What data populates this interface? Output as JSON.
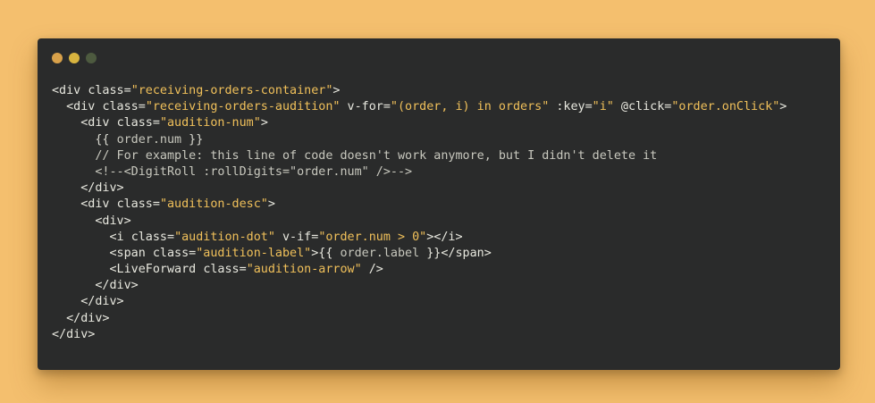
{
  "window": {
    "traffic_lights": [
      {
        "name": "close",
        "color": "#d8a14a"
      },
      {
        "name": "minimize",
        "color": "#d8b43f"
      },
      {
        "name": "maximize",
        "color": "#4d5a3f"
      }
    ]
  },
  "code": {
    "colors": {
      "string": "#f0c05a",
      "text": "#e8e8df",
      "background": "#2a2b2b",
      "page_background": "#f4bf6e"
    },
    "lines": [
      [
        {
          "t": "<div ",
          "k": "tag"
        },
        {
          "t": "class=",
          "k": "attr"
        },
        {
          "t": "\"receiving-orders-container\"",
          "k": "str"
        },
        {
          "t": ">",
          "k": "punc"
        }
      ],
      [
        {
          "t": "  <div ",
          "k": "tag"
        },
        {
          "t": "class=",
          "k": "attr"
        },
        {
          "t": "\"receiving-orders-audition\"",
          "k": "str"
        },
        {
          "t": " v-for=",
          "k": "attr"
        },
        {
          "t": "\"(order, i) in orders\"",
          "k": "str"
        },
        {
          "t": " :key=",
          "k": "attr"
        },
        {
          "t": "\"i\"",
          "k": "str"
        },
        {
          "t": " @click=",
          "k": "attr"
        },
        {
          "t": "\"order.onClick\"",
          "k": "str"
        },
        {
          "t": ">",
          "k": "punc"
        }
      ],
      [
        {
          "t": "    <div ",
          "k": "tag"
        },
        {
          "t": "class=",
          "k": "attr"
        },
        {
          "t": "\"audition-num\"",
          "k": "str"
        },
        {
          "t": ">",
          "k": "punc"
        }
      ],
      [
        {
          "t": "      {{ ",
          "k": "plain"
        },
        {
          "t": "order.num",
          "k": "expr"
        },
        {
          "t": " }}",
          "k": "plain"
        }
      ],
      [
        {
          "t": "      // For example: this line of code doesn't work anymore, but I didn't delete it",
          "k": "comment"
        }
      ],
      [
        {
          "t": "      <!--<DigitRoll :rollDigits=\"order.num\" />-->",
          "k": "comment"
        }
      ],
      [
        {
          "t": "    </div>",
          "k": "tag"
        }
      ],
      [
        {
          "t": "    <div ",
          "k": "tag"
        },
        {
          "t": "class=",
          "k": "attr"
        },
        {
          "t": "\"audition-desc\"",
          "k": "str"
        },
        {
          "t": ">",
          "k": "punc"
        }
      ],
      [
        {
          "t": "      <div>",
          "k": "tag"
        }
      ],
      [
        {
          "t": "        <i ",
          "k": "tag"
        },
        {
          "t": "class=",
          "k": "attr"
        },
        {
          "t": "\"audition-dot\"",
          "k": "str"
        },
        {
          "t": " v-if=",
          "k": "attr"
        },
        {
          "t": "\"order.num > 0\"",
          "k": "str"
        },
        {
          "t": "></i>",
          "k": "punc"
        }
      ],
      [
        {
          "t": "        <span ",
          "k": "tag"
        },
        {
          "t": "class=",
          "k": "attr"
        },
        {
          "t": "\"audition-label\"",
          "k": "str"
        },
        {
          "t": ">{{ ",
          "k": "punc"
        },
        {
          "t": "order.label",
          "k": "expr"
        },
        {
          "t": " }}</span>",
          "k": "punc"
        }
      ],
      [
        {
          "t": "        <LiveForward ",
          "k": "tag"
        },
        {
          "t": "class=",
          "k": "attr"
        },
        {
          "t": "\"audition-arrow\"",
          "k": "str"
        },
        {
          "t": " />",
          "k": "punc"
        }
      ],
      [
        {
          "t": "      </div>",
          "k": "tag"
        }
      ],
      [
        {
          "t": "    </div>",
          "k": "tag"
        }
      ],
      [
        {
          "t": "  </div>",
          "k": "tag"
        }
      ],
      [
        {
          "t": "</div>",
          "k": "tag"
        }
      ]
    ]
  }
}
